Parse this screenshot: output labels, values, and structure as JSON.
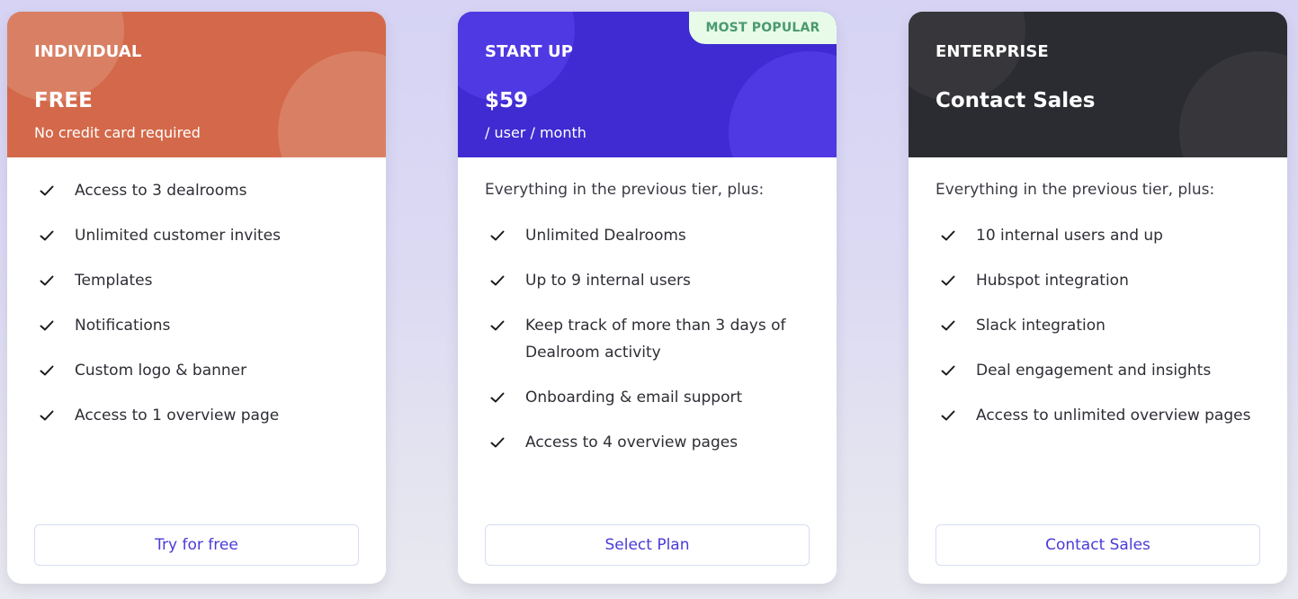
{
  "colors": {
    "individual_header": "#d3694a",
    "individual_circle": "#d98064",
    "startup_header": "#3f2bd1",
    "startup_circle": "#4f39e3",
    "enterprise_header": "#2a2c31",
    "enterprise_circle": "#3a3a3b",
    "accent": "#4a3ad8",
    "badge_bg": "#e8fbe9",
    "badge_text": "#4a9a6d"
  },
  "plans": [
    {
      "name": "INDIVIDUAL",
      "price": "FREE",
      "subtitle": "No credit card required",
      "intro": "",
      "features": [
        "Access to 3 dealrooms",
        "Unlimited customer invites",
        "Templates",
        "Notifications",
        "Custom logo & banner",
        "Access to 1 overview page"
      ],
      "cta": "Try for free"
    },
    {
      "name": "START UP",
      "badge": "MOST POPULAR",
      "price": "$59",
      "subtitle": "/ user / month",
      "intro": "Everything in the previous tier, plus:",
      "features": [
        "Unlimited Dealrooms",
        "Up to 9 internal users",
        "Keep track of more than 3 days of Dealroom activity",
        "Onboarding & email support",
        "Access to 4 overview pages"
      ],
      "cta": "Select Plan"
    },
    {
      "name": "ENTERPRISE",
      "price": "Contact Sales",
      "subtitle": "",
      "intro": "Everything in the previous tier, plus:",
      "features": [
        "10 internal users and up",
        "Hubspot integration",
        "Slack integration",
        "Deal engagement and insights",
        "Access to unlimited overview pages"
      ],
      "cta": "Contact Sales"
    }
  ]
}
